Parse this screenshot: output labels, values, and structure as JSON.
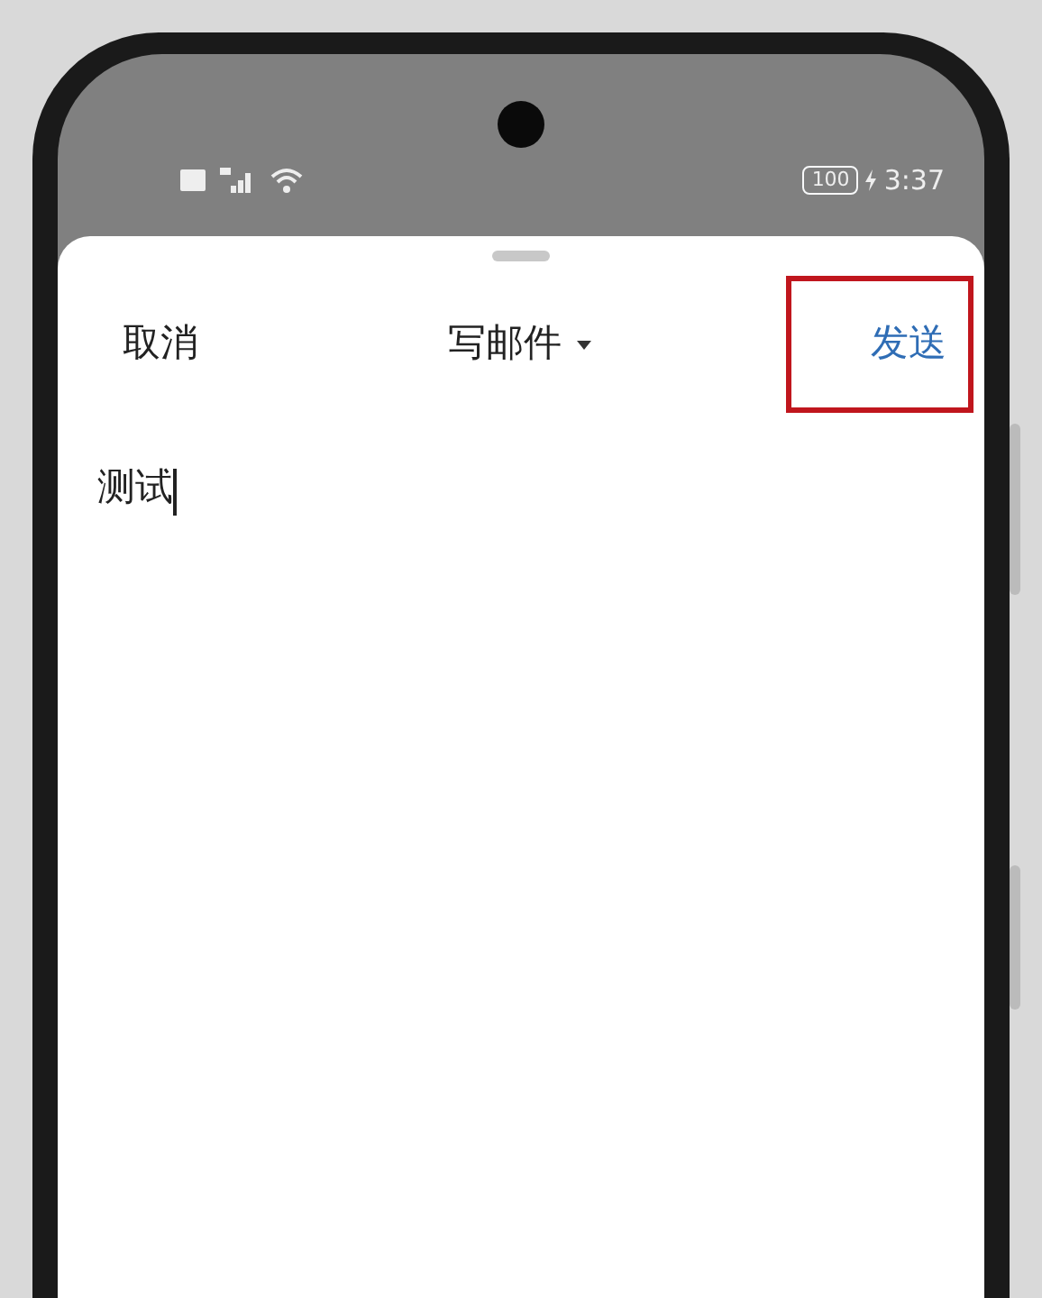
{
  "status_bar": {
    "battery": "100",
    "time": "3:37"
  },
  "sheet": {
    "cancel": "取消",
    "title": "写邮件",
    "title_dropdown": true,
    "send": "发送",
    "send_highlighted": true
  },
  "body": {
    "text": "测试",
    "cursor": true
  }
}
